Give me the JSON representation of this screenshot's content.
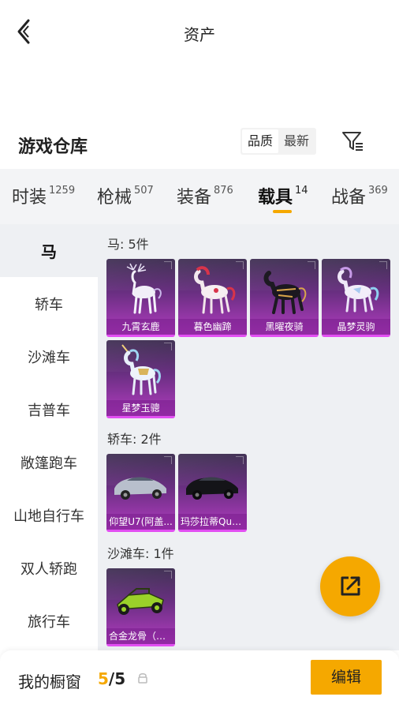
{
  "header": {
    "title": "资产"
  },
  "section": {
    "title": "游戏仓库",
    "sort_options": [
      "品质",
      "最新"
    ],
    "sort_selected": "品质"
  },
  "tabs": [
    {
      "label": "时装",
      "count": "1259"
    },
    {
      "label": "枪械",
      "count": "507"
    },
    {
      "label": "装备",
      "count": "876"
    },
    {
      "label": "载具",
      "count": "14"
    },
    {
      "label": "战备",
      "count": "369"
    }
  ],
  "active_tab": "载具",
  "sidebar": {
    "items": [
      "马",
      "轿车",
      "沙滩车",
      "吉普车",
      "敞篷跑车",
      "山地自行车",
      "双人轿跑",
      "旅行车"
    ],
    "selected": "马"
  },
  "groups": [
    {
      "label": "马: 5件",
      "items": [
        {
          "name": "九霄玄鹿",
          "icon": "white-stag-icon"
        },
        {
          "name": "暮色幽蹄",
          "icon": "red-white-horse-icon"
        },
        {
          "name": "黑曜夜骑",
          "icon": "black-gold-horse-icon"
        },
        {
          "name": "晶梦灵驹",
          "icon": "crystal-horse-icon"
        },
        {
          "name": "星梦玉骢",
          "icon": "unicorn-icon"
        }
      ]
    },
    {
      "label": "轿车: 2件",
      "items": [
        {
          "name": "仰望U7(阿盖...",
          "icon": "silver-sedan-icon"
        },
        {
          "name": "玛莎拉蒂Qua...",
          "icon": "black-sedan-icon"
        }
      ]
    },
    {
      "label": "沙滩车: 1件",
      "items": [
        {
          "name": "合金龙骨（绿...",
          "icon": "green-buggy-icon"
        }
      ]
    }
  ],
  "showcase": {
    "label": "我的橱窗",
    "current": "5",
    "total": "/5"
  },
  "edit_label": "编辑",
  "colors": {
    "accent": "#f5a800",
    "card_purple": "#6a2f82",
    "card_border": "#e24ff2"
  }
}
